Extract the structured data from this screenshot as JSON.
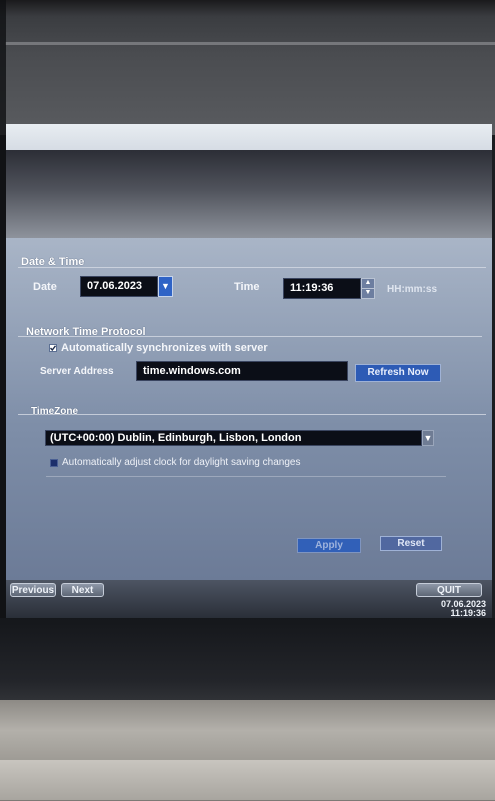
{
  "date_time": {
    "title": "Date & Time",
    "date_label": "Date",
    "date_value": "07.06.2023",
    "time_label": "Time",
    "time_value": "11:19:36",
    "time_format": "HH:mm:ss"
  },
  "ntp": {
    "title": "Network Time Protocol",
    "auto_sync_label": "Automatically synchronizes with server",
    "auto_sync_checked": true,
    "server_label": "Server Address",
    "server_value": "time.windows.com",
    "refresh_label": "Refresh Now"
  },
  "timezone": {
    "title": "TimeZone",
    "selected": "(UTC+00:00) Dublin, Edinburgh, Lisbon, London",
    "dst_label": "Automatically adjust clock for daylight saving changes",
    "dst_checked": false
  },
  "actions": {
    "apply_label": "Apply",
    "reset_label": "Reset"
  },
  "footer": {
    "previous_label": "Previous",
    "next_label": "Next",
    "quit_label": "QUIT",
    "clock_date": "07.06.2023",
    "clock_time": "11:19:36"
  },
  "colors": {
    "panel": "#8d9bb4",
    "field_bg": "#0b0e17",
    "dropdown_accent": "#2f63c6",
    "button_bg": "#2d5bb5"
  },
  "icons": {
    "date_dropdown": "chevron-down-icon",
    "timezone_dropdown": "chevron-down-icon",
    "time_spinner": "spin-up-down-icon"
  }
}
